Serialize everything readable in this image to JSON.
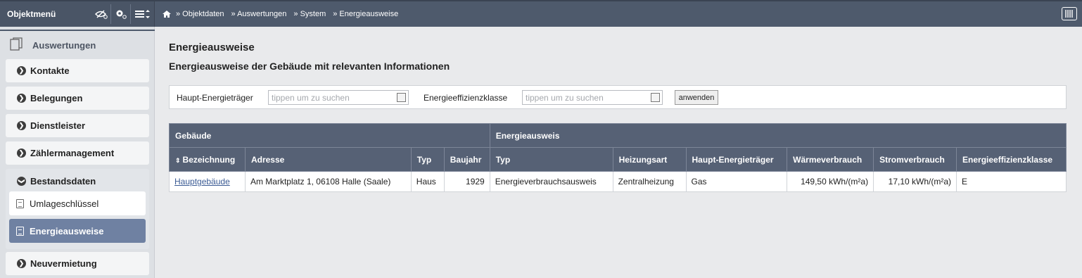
{
  "topbar": {
    "title": "Objektmenü",
    "icons": [
      "eye-settings-icon",
      "gear-icon",
      "menu-list-icon"
    ],
    "breadcrumb": [
      "»  Objektdaten",
      "»  Auswertungen",
      "» System",
      "» Energieausweise"
    ],
    "right_icon": "columns-icon"
  },
  "sidebar": {
    "header": "Auswertungen",
    "items": [
      {
        "label": "Kontakte"
      },
      {
        "label": "Belegungen"
      },
      {
        "label": "Dienstleister"
      },
      {
        "label": "Zählermanagement"
      }
    ],
    "group": {
      "label": "Bestandsdaten",
      "children": [
        {
          "label": "Umlageschlüssel"
        },
        {
          "label": "Energieausweise",
          "active": true
        }
      ]
    },
    "after": {
      "label": "Neuvermietung"
    }
  },
  "main": {
    "title": "Energieausweise",
    "subtitle": "Energieausweise der Gebäude mit relevanten Informationen",
    "filter": {
      "label1": "Haupt-Energieträger",
      "placeholder1": "tippen um zu suchen",
      "label2": "Energieeffizienzklasse",
      "placeholder2": "tippen um zu suchen",
      "apply": "anwenden"
    },
    "table": {
      "group1": "Gebäude",
      "group2": "Energieausweis",
      "columns": [
        "Bezeichnung",
        "Adresse",
        "Typ",
        "Baujahr",
        "Typ",
        "Heizungsart",
        "Haupt-Energieträger",
        "Wärmeverbrauch",
        "Stromverbrauch",
        "Energieeffizienzklasse"
      ],
      "rows": [
        [
          "Hauptgebäude",
          "Am Marktplatz 1, 06108 Halle (Saale)",
          "Haus",
          "1929",
          "Energieverbrauchsausweis",
          "Zentralheizung",
          "Gas",
          "149,50 kWh/(m²a)",
          "17,10 kWh/(m²a)",
          "E"
        ]
      ]
    }
  },
  "colors": {
    "topbar": "#4e5a6c",
    "header": "#566175",
    "active": "#6f81a2",
    "link": "#3b5b94"
  }
}
